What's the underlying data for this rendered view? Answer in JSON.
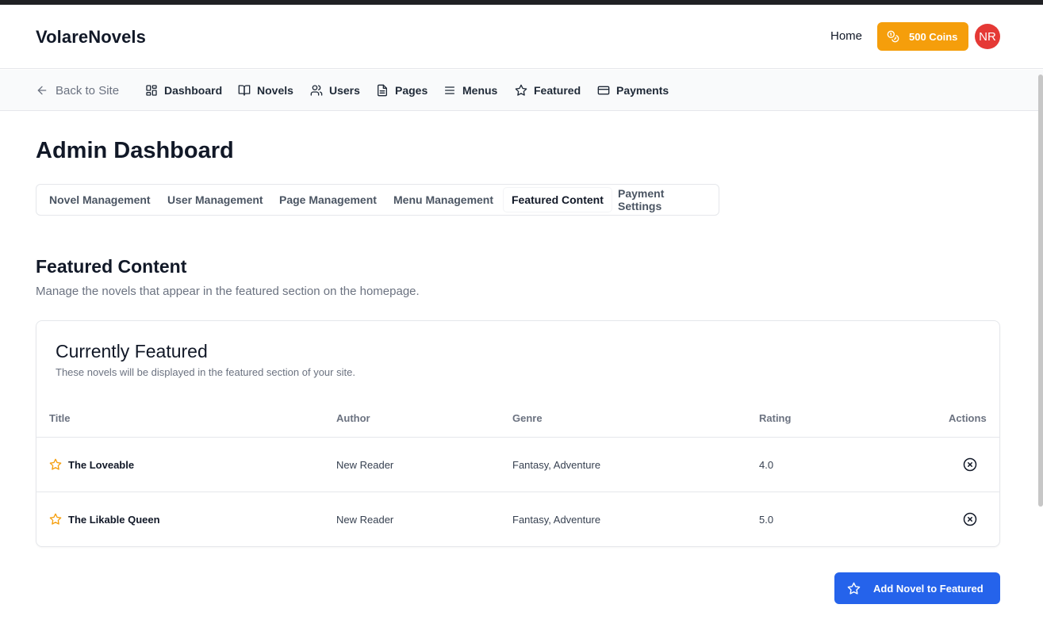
{
  "header": {
    "brand": "VolareNovels",
    "home_link": "Home",
    "coins_label": "500 Coins",
    "avatar_initials": "NR",
    "colors": {
      "coins_bg": "#f59e0b",
      "avatar_bg": "#e53935"
    }
  },
  "admin_nav": {
    "back_label": "Back to Site",
    "items": [
      {
        "label": "Dashboard",
        "icon": "layout-grid-icon"
      },
      {
        "label": "Novels",
        "icon": "book-open-icon"
      },
      {
        "label": "Users",
        "icon": "users-icon"
      },
      {
        "label": "Pages",
        "icon": "file-text-icon"
      },
      {
        "label": "Menus",
        "icon": "menu-icon"
      },
      {
        "label": "Featured",
        "icon": "star-icon"
      },
      {
        "label": "Payments",
        "icon": "credit-card-icon"
      }
    ]
  },
  "page": {
    "title": "Admin Dashboard"
  },
  "tabs": [
    {
      "label": "Novel Management",
      "active": false
    },
    {
      "label": "User Management",
      "active": false
    },
    {
      "label": "Page Management",
      "active": false
    },
    {
      "label": "Menu Management",
      "active": false
    },
    {
      "label": "Featured Content",
      "active": true
    },
    {
      "label": "Payment Settings",
      "active": false
    }
  ],
  "section": {
    "title": "Featured Content",
    "description": "Manage the novels that appear in the featured section on the homepage."
  },
  "card": {
    "title": "Currently Featured",
    "description": "These novels will be displayed in the featured section of your site.",
    "columns": [
      "Title",
      "Author",
      "Genre",
      "Rating",
      "Actions"
    ],
    "rows": [
      {
        "title": "The Loveable",
        "author": "New Reader",
        "genre": "Fantasy, Adventure",
        "rating": "4.0",
        "action_icon": "x-circle-icon"
      },
      {
        "title": "The Likable Queen",
        "author": "New Reader",
        "genre": "Fantasy, Adventure",
        "rating": "5.0",
        "action_icon": "x-circle-icon"
      }
    ]
  },
  "add_button": {
    "label": "Add Novel to Featured",
    "icon": "star-icon",
    "color": "#2563eb"
  }
}
